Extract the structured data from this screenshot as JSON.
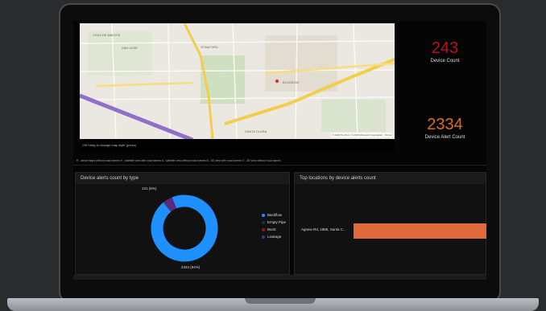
{
  "kpis": [
    {
      "value": "243",
      "label": "Device Count",
      "color": "#b3151c"
    },
    {
      "value": "2334",
      "label": "Device Alert Count",
      "color": "#e06a23"
    }
  ],
  "map": {
    "labels": [
      "CASA DE AMIGOS",
      "SAN JOSE",
      "STANFORD",
      "BLOSSOM",
      "SANTA CLARA"
    ],
    "attribution": "© 2020 TomTom, © 2020 Microsoft Corporation · Terms",
    "note": "Ctrl+drag to change map style (press)",
    "help": "R - aerial maps without road names   H - satellite view with road names   A - satellite view without road names   B - 3D view with road names   O - 3D view without road names"
  },
  "donut": {
    "title": "Device alerts count by type",
    "small_label": "121 (5%)",
    "big_label": "2334 (94%)",
    "legend": [
      {
        "name": "Backflow",
        "color": "#1e90ff"
      },
      {
        "name": "Empty Pipe",
        "color": "#1c2b5a"
      },
      {
        "name": "Burst",
        "color": "#8b1a1a"
      },
      {
        "name": "Leakage",
        "color": "#5a2a7a"
      }
    ]
  },
  "bar": {
    "title": "Top locations by device alerts count",
    "location": "Agnew Rd, 1885, Santa C...",
    "color": "#e06a3a"
  },
  "chart_data": [
    {
      "type": "pie",
      "title": "Device alerts count by type",
      "categories": [
        "Backflow",
        "Empty Pipe",
        "Burst",
        "Leakage"
      ],
      "values": [
        2334,
        0,
        0,
        121
      ],
      "percent_labels": [
        "94%",
        "",
        "",
        "5%"
      ]
    },
    {
      "type": "bar",
      "title": "Top locations by device alerts count",
      "categories": [
        "Agnew Rd, 1885, Santa C..."
      ],
      "values": [
        2334
      ]
    }
  ]
}
